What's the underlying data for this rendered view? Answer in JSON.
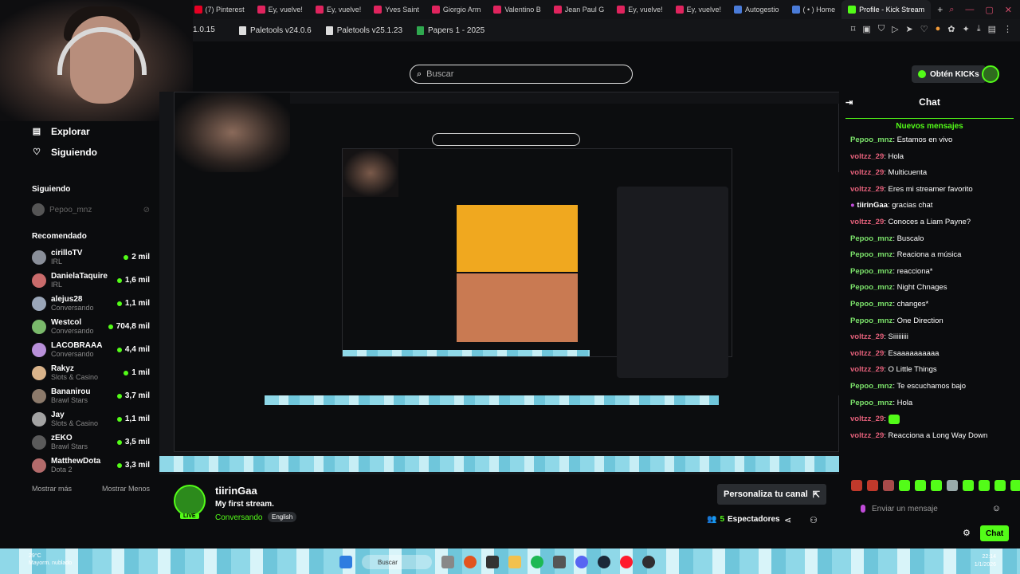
{
  "browser": {
    "tabs": [
      {
        "label": "(7) Pinterest",
        "color": "#e60023"
      },
      {
        "label": "Ey, vuelve!",
        "color": "#e0245e"
      },
      {
        "label": "Ey, vuelve!",
        "color": "#e0245e"
      },
      {
        "label": "Yves Saint",
        "color": "#e0245e"
      },
      {
        "label": "Giorgio Arm",
        "color": "#e0245e"
      },
      {
        "label": "Valentino B",
        "color": "#e0245e"
      },
      {
        "label": "Jean Paul G",
        "color": "#e0245e"
      },
      {
        "label": "Ey, vuelve!",
        "color": "#e0245e"
      },
      {
        "label": "Ey, vuelve!",
        "color": "#e0245e"
      },
      {
        "label": "Autogestio",
        "color": "#4a7bd8"
      },
      {
        "label": "( • ) Home",
        "color": "#4a7bd8"
      },
      {
        "label": "Profile - Kick Stream",
        "color": "#53fc18",
        "active": true
      }
    ],
    "version_text": "1.0.15",
    "bookmarks": [
      "Paletools v24.0.6",
      "Paletools v25.1.23",
      "Papers 1 - 2025"
    ]
  },
  "header": {
    "search_placeholder": "Buscar",
    "kicks_label": "Obtén KICKs"
  },
  "sidebar": {
    "nav": [
      {
        "label": "Explorar",
        "icon": "compass-icon"
      },
      {
        "label": "Siguiendo",
        "icon": "heart-icon"
      }
    ],
    "following_title": "Siguiendo",
    "following": [
      {
        "name": "Pepoo_mnz"
      }
    ],
    "recommended_title": "Recomendado",
    "recommended": [
      {
        "name": "cirilloTV",
        "category": "IRL",
        "viewers": "2 mil",
        "color": "#8a8f99"
      },
      {
        "name": "DanielaTaquire",
        "category": "IRL",
        "viewers": "1,6 mil",
        "color": "#c96b6b"
      },
      {
        "name": "alejus28",
        "category": "Conversando",
        "viewers": "1,1 mil",
        "color": "#9aa6b8"
      },
      {
        "name": "Westcol",
        "category": "Conversando",
        "viewers": "704,8 mil",
        "color": "#7ab96b"
      },
      {
        "name": "LACOBRAAA",
        "category": "Conversando",
        "viewers": "4,4 mil",
        "color": "#b890d9"
      },
      {
        "name": "Rakyz",
        "category": "Slots & Casino",
        "viewers": "1 mil",
        "color": "#d9b38a"
      },
      {
        "name": "Bananirou",
        "category": "Brawl Stars",
        "viewers": "3,7 mil",
        "color": "#8c7a6b"
      },
      {
        "name": "Jay",
        "category": "Slots & Casino",
        "viewers": "1,1 mil",
        "color": "#a3a3a3"
      },
      {
        "name": "zEKO",
        "category": "Brawl Stars",
        "viewers": "3,5 mil",
        "color": "#5a5a5a"
      },
      {
        "name": "MatthewDota",
        "category": "Dota 2",
        "viewers": "3,3 mil",
        "color": "#b36b6b"
      }
    ],
    "show_more": "Mostrar más",
    "show_less": "Mostrar Menos"
  },
  "stream": {
    "channel": "tiirinGaa",
    "title": "My first stream.",
    "category": "Conversando",
    "language": "English",
    "live_badge": "LIVE",
    "customize_label": "Personaliza tu canal",
    "viewers_count": "5",
    "viewers_label": "Espectadores"
  },
  "chat": {
    "title": "Chat",
    "new_messages": "Nuevos mensajes",
    "messages": [
      {
        "user": "Pepoo_mnz",
        "text": "Estamos en vivo",
        "color": "pe"
      },
      {
        "user": "voltzz_29",
        "text": "Hola",
        "color": "vo"
      },
      {
        "user": "voltzz_29",
        "text": "Multicuenta",
        "color": "vo"
      },
      {
        "user": "voltzz_29",
        "text": "Eres mi streamer favorito",
        "color": "vo"
      },
      {
        "user": "tiirinGaa",
        "text": "gracias chat",
        "color": "ti"
      },
      {
        "user": "voltzz_29",
        "text": "Conoces a Liam Payne?",
        "color": "vo"
      },
      {
        "user": "Pepoo_mnz",
        "text": "Buscalo",
        "color": "pe"
      },
      {
        "user": "Pepoo_mnz",
        "text": "Reaciona a música",
        "color": "pe"
      },
      {
        "user": "Pepoo_mnz",
        "text": "reacciona*",
        "color": "pe"
      },
      {
        "user": "Pepoo_mnz",
        "text": "Night Chnages",
        "color": "pe"
      },
      {
        "user": "Pepoo_mnz",
        "text": "changes*",
        "color": "pe"
      },
      {
        "user": "Pepoo_mnz",
        "text": "One Direction",
        "color": "pe"
      },
      {
        "user": "voltzz_29",
        "text": "Siiiiiiiii",
        "color": "vo"
      },
      {
        "user": "voltzz_29",
        "text": "Esaaaaaaaaaa",
        "color": "vo"
      },
      {
        "user": "voltzz_29",
        "text": "O Little Things",
        "color": "vo"
      },
      {
        "user": "Pepoo_mnz",
        "text": "Te escuchamos bajo",
        "color": "pe"
      },
      {
        "user": "Pepoo_mnz",
        "text": "Hola",
        "color": "pe"
      },
      {
        "user": "voltzz_29",
        "text": "",
        "color": "vo",
        "emote": true
      },
      {
        "user": "voltzz_29",
        "text": "Reacciona a Long Way Down",
        "color": "vo"
      }
    ],
    "input_placeholder": "Enviar un mensaje",
    "send_label": "Chat",
    "emote_colors": [
      "#c0392b",
      "#c0392b",
      "#a84a4a",
      "#53fc18",
      "#53fc18",
      "#53fc18",
      "#9aa",
      "#53fc18",
      "#53fc18",
      "#53fc18",
      "#53fc18"
    ]
  },
  "taskbar": {
    "weather_temp": "29°C",
    "weather_text": "Mayorm. nublado",
    "search_text": "Buscar",
    "time": "22:14",
    "date": "1/1/2026"
  }
}
